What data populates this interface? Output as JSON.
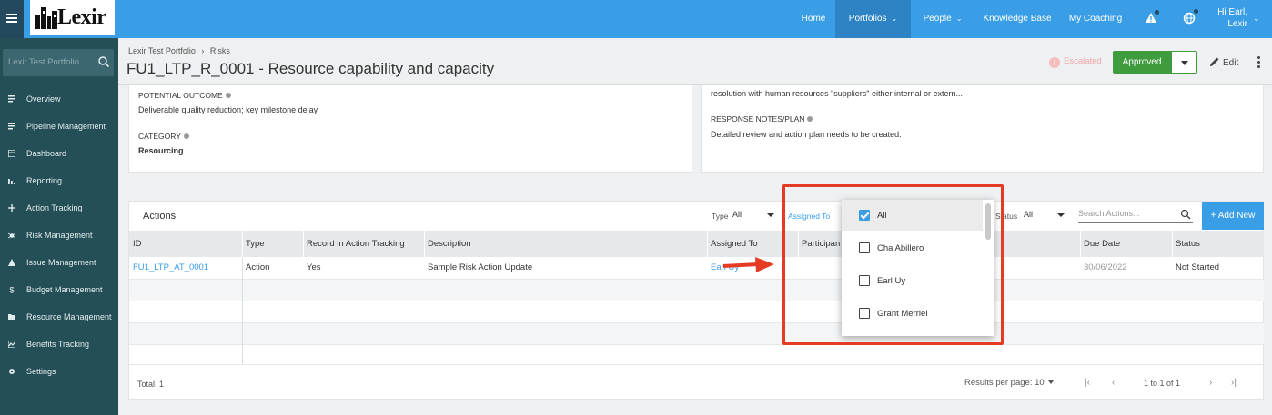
{
  "topbar": {
    "brand": "Lexir",
    "nav": [
      {
        "label": "Home",
        "has_menu": false,
        "active": false
      },
      {
        "label": "Portfolios",
        "has_menu": true,
        "active": true
      },
      {
        "label": "People",
        "has_menu": true,
        "active": false
      },
      {
        "label": "Knowledge Base",
        "has_menu": false,
        "active": false
      },
      {
        "label": "My Coaching",
        "has_menu": false,
        "active": false
      }
    ],
    "icons": [
      "warning-icon",
      "globe-icon"
    ],
    "user": {
      "greeting": "Hi Earl,",
      "org": "Lexir"
    }
  },
  "sidebar": {
    "search_placeholder": "Lexir Test Portfolio",
    "items": [
      {
        "label": "Overview",
        "icon": "list-icon"
      },
      {
        "label": "Pipeline Management",
        "icon": "list-icon"
      },
      {
        "label": "Dashboard",
        "icon": "dashboard-icon"
      },
      {
        "label": "Reporting",
        "icon": "bar-chart-icon"
      },
      {
        "label": "Action Tracking",
        "icon": "move-icon"
      },
      {
        "label": "Risk Management",
        "icon": "bug-icon"
      },
      {
        "label": "Issue Management",
        "icon": "warning-icon"
      },
      {
        "label": "Budget Management",
        "icon": "dollar-icon"
      },
      {
        "label": "Resource Management",
        "icon": "folder-icon"
      },
      {
        "label": "Benefits Tracking",
        "icon": "line-chart-icon"
      },
      {
        "label": "Settings",
        "icon": "gear-icon"
      }
    ]
  },
  "header": {
    "breadcrumb": [
      "Lexir Test Portfolio",
      "Risks"
    ],
    "breadcrumb_sep": "›",
    "title": "FU1_LTP_R_0001 - Resource capability and capacity",
    "escalated": "Escalated",
    "status_button": "Approved",
    "edit": "Edit"
  },
  "details": {
    "left": {
      "potential_outcome_label": "POTENTIAL OUTCOME",
      "potential_outcome": "Deliverable quality reduction; key milestone delay",
      "category_label": "CATEGORY",
      "category": "Resourcing"
    },
    "right": {
      "truncated_line": "resolution with human resources \"suppliers\" either internal or extern...",
      "response_label": "RESPONSE NOTES/PLAN",
      "response": "Detailed review and action plan needs to be created."
    }
  },
  "actions": {
    "title": "Actions",
    "filters": {
      "type_label": "Type",
      "type_value": "All",
      "assigned_label": "Assigned To",
      "status_label": "Status",
      "status_value": "All",
      "search_placeholder": "Search Actions..."
    },
    "add_new": "+ Add New",
    "columns": [
      "ID",
      "Type",
      "Record in Action Tracking",
      "Description",
      "Assigned To",
      "Participan",
      "",
      "Due Date",
      "Status"
    ],
    "rows": [
      {
        "id": "FU1_LTP_AT_0001",
        "type": "Action",
        "record": "Yes",
        "description": "Sample Risk Action Update",
        "assigned": "Earl Uy",
        "due": "30/06/2022",
        "status": "Not Started"
      }
    ],
    "total": "Total: 1",
    "results_per_page": "Results per page: 10",
    "range": "1 to 1 of 1"
  },
  "assigned_dropdown": {
    "options": [
      {
        "label": "All",
        "checked": true
      },
      {
        "label": "Cha Abillero",
        "checked": false
      },
      {
        "label": "Earl Uy",
        "checked": false
      },
      {
        "label": "Grant Merriel",
        "checked": false
      }
    ]
  },
  "colors": {
    "topbar": "#3a9ee6",
    "sidebar": "#244f57",
    "approved": "#3e9b3e",
    "annotation": "#e53a24"
  }
}
